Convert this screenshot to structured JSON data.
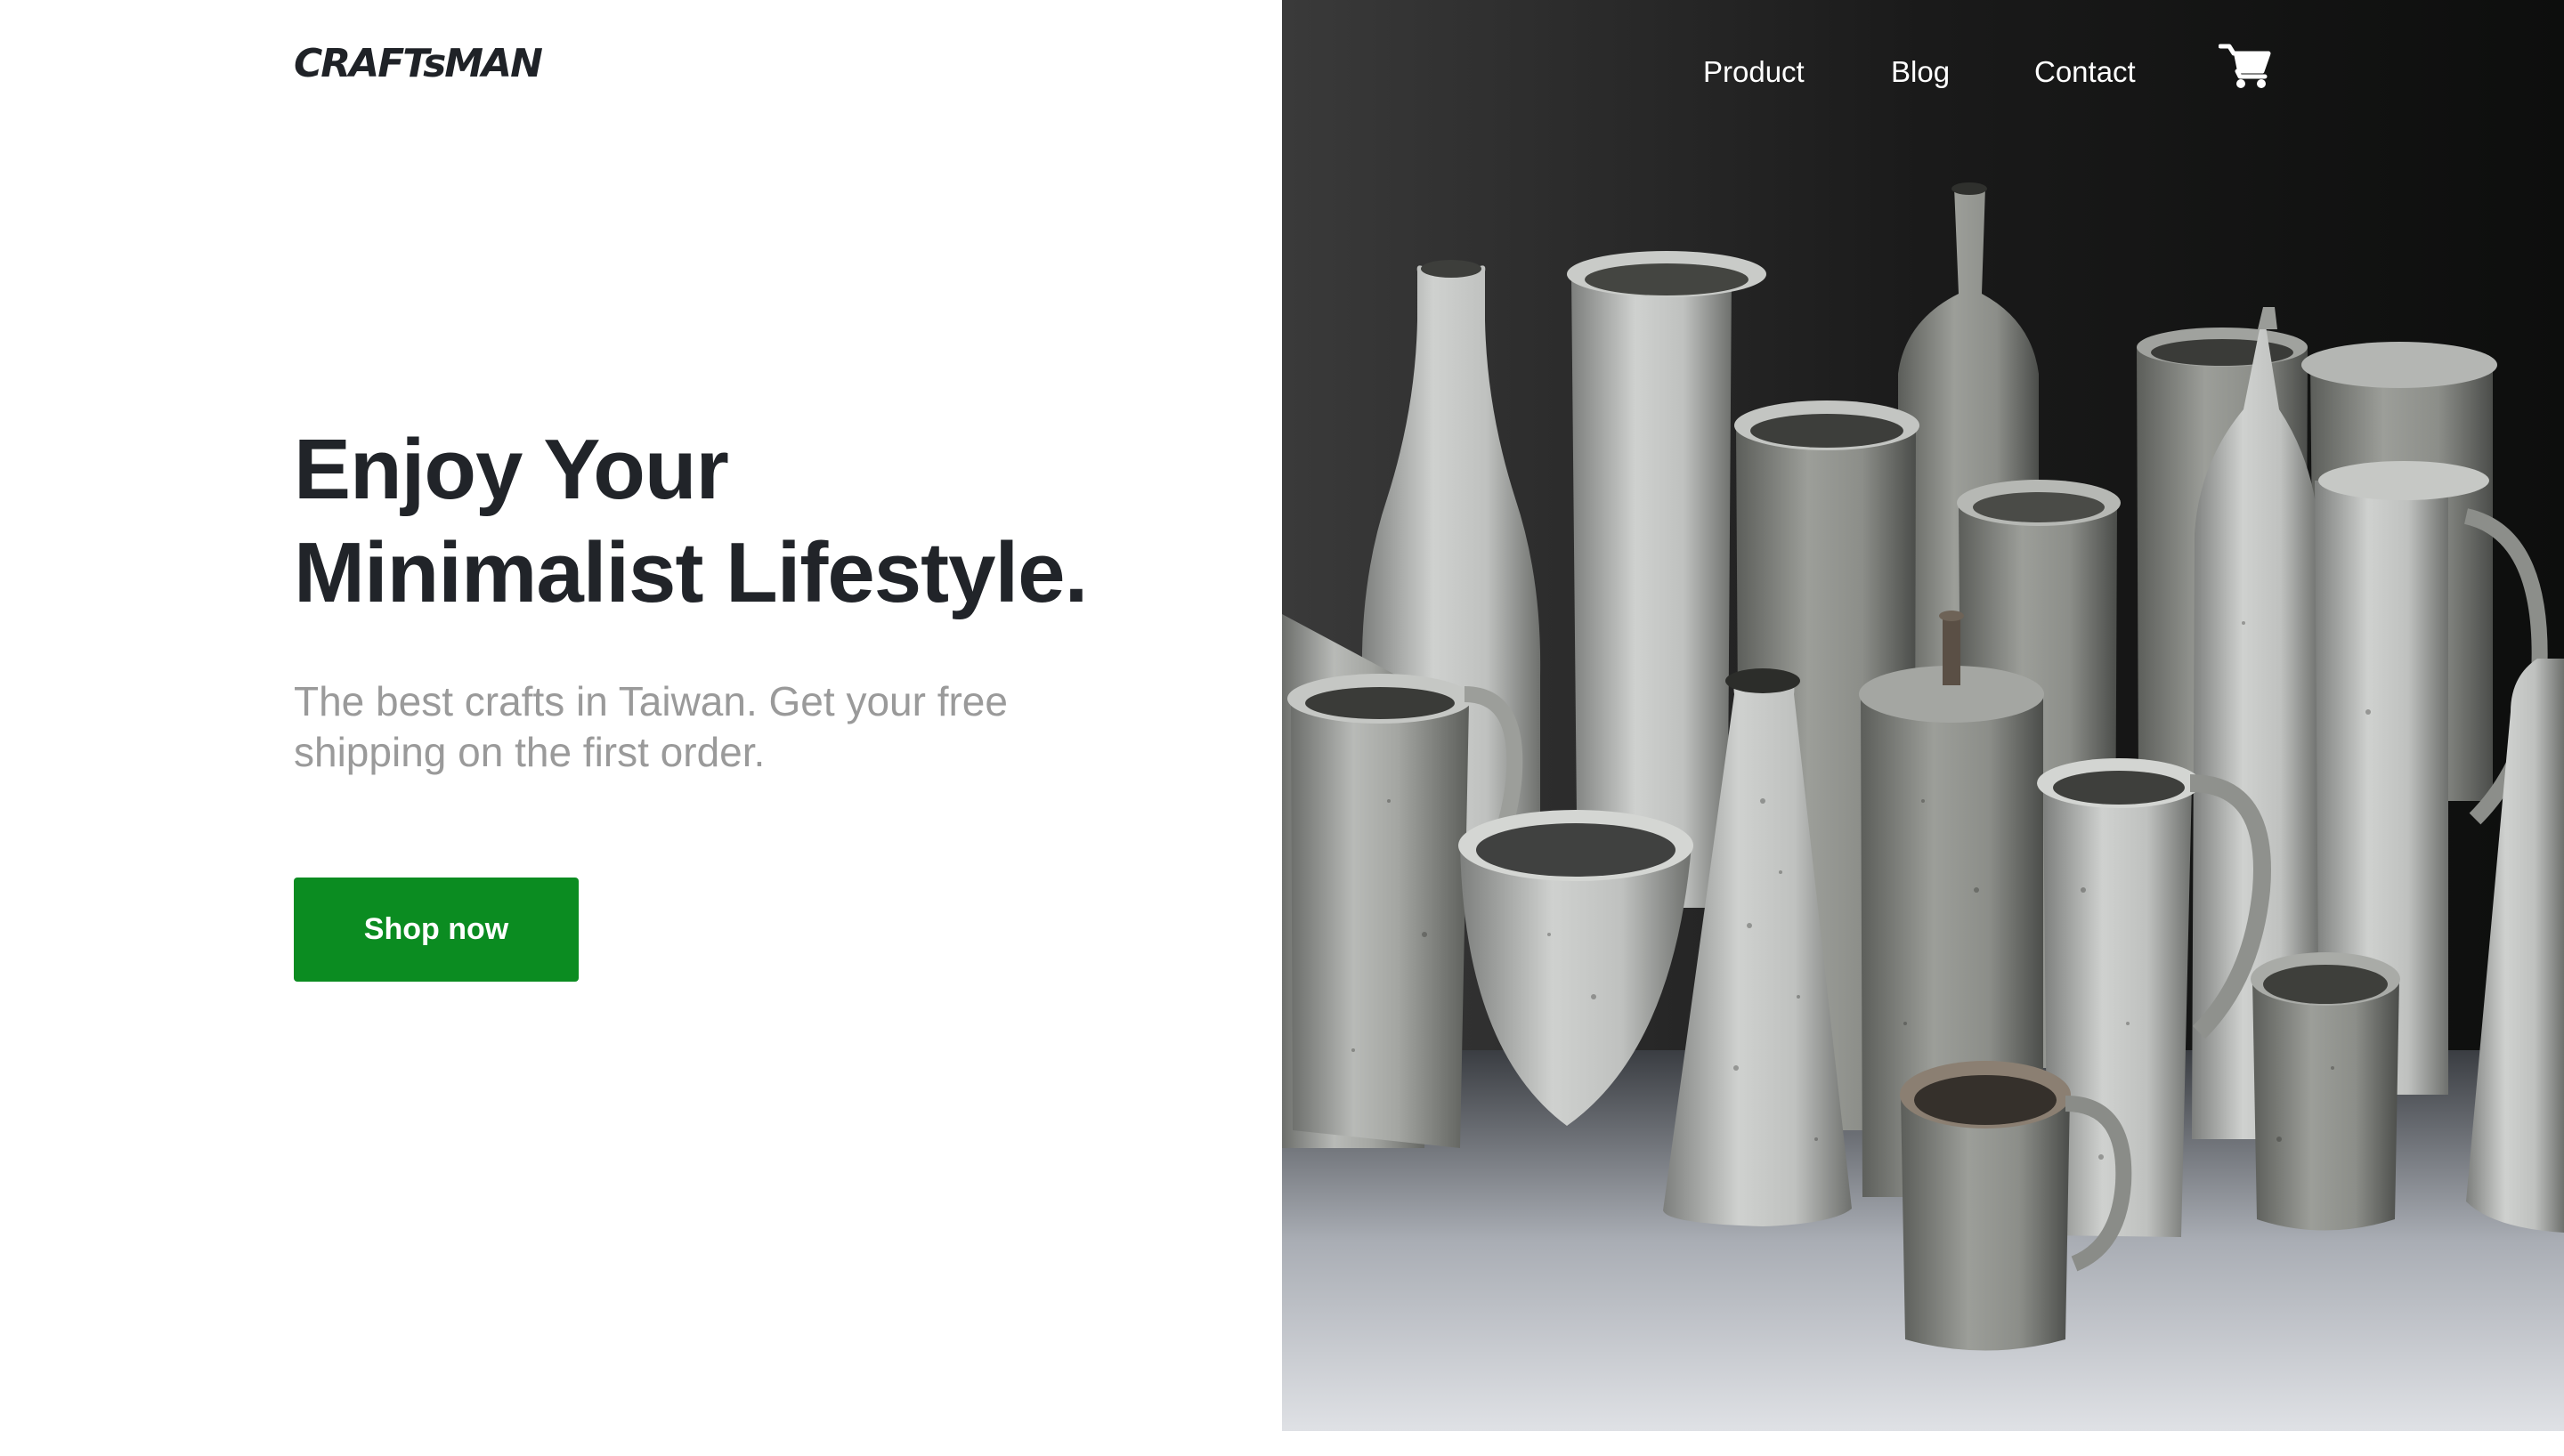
{
  "brand": {
    "logo_text": "CRAFTsMAN"
  },
  "nav": {
    "items": [
      {
        "label": "Product"
      },
      {
        "label": "Blog"
      },
      {
        "label": "Contact"
      }
    ],
    "cart_icon": "shopping-cart-icon"
  },
  "hero": {
    "headline_line1": "Enjoy Your",
    "headline_line2": "Minimalist Lifestyle.",
    "subtext_line1": "The best crafts in Taiwan. Get your free",
    "subtext_line2": "shipping on the first order.",
    "cta_label": "Shop now",
    "image_alt": "Grey ceramic vases, bottles, pitchers and cups"
  },
  "colors": {
    "brand_text": "#1f2227",
    "headline": "#212429",
    "subtext": "#9a9a9a",
    "cta_background": "#0b8c21",
    "cta_text": "#ffffff",
    "hero_background": "#151615"
  }
}
